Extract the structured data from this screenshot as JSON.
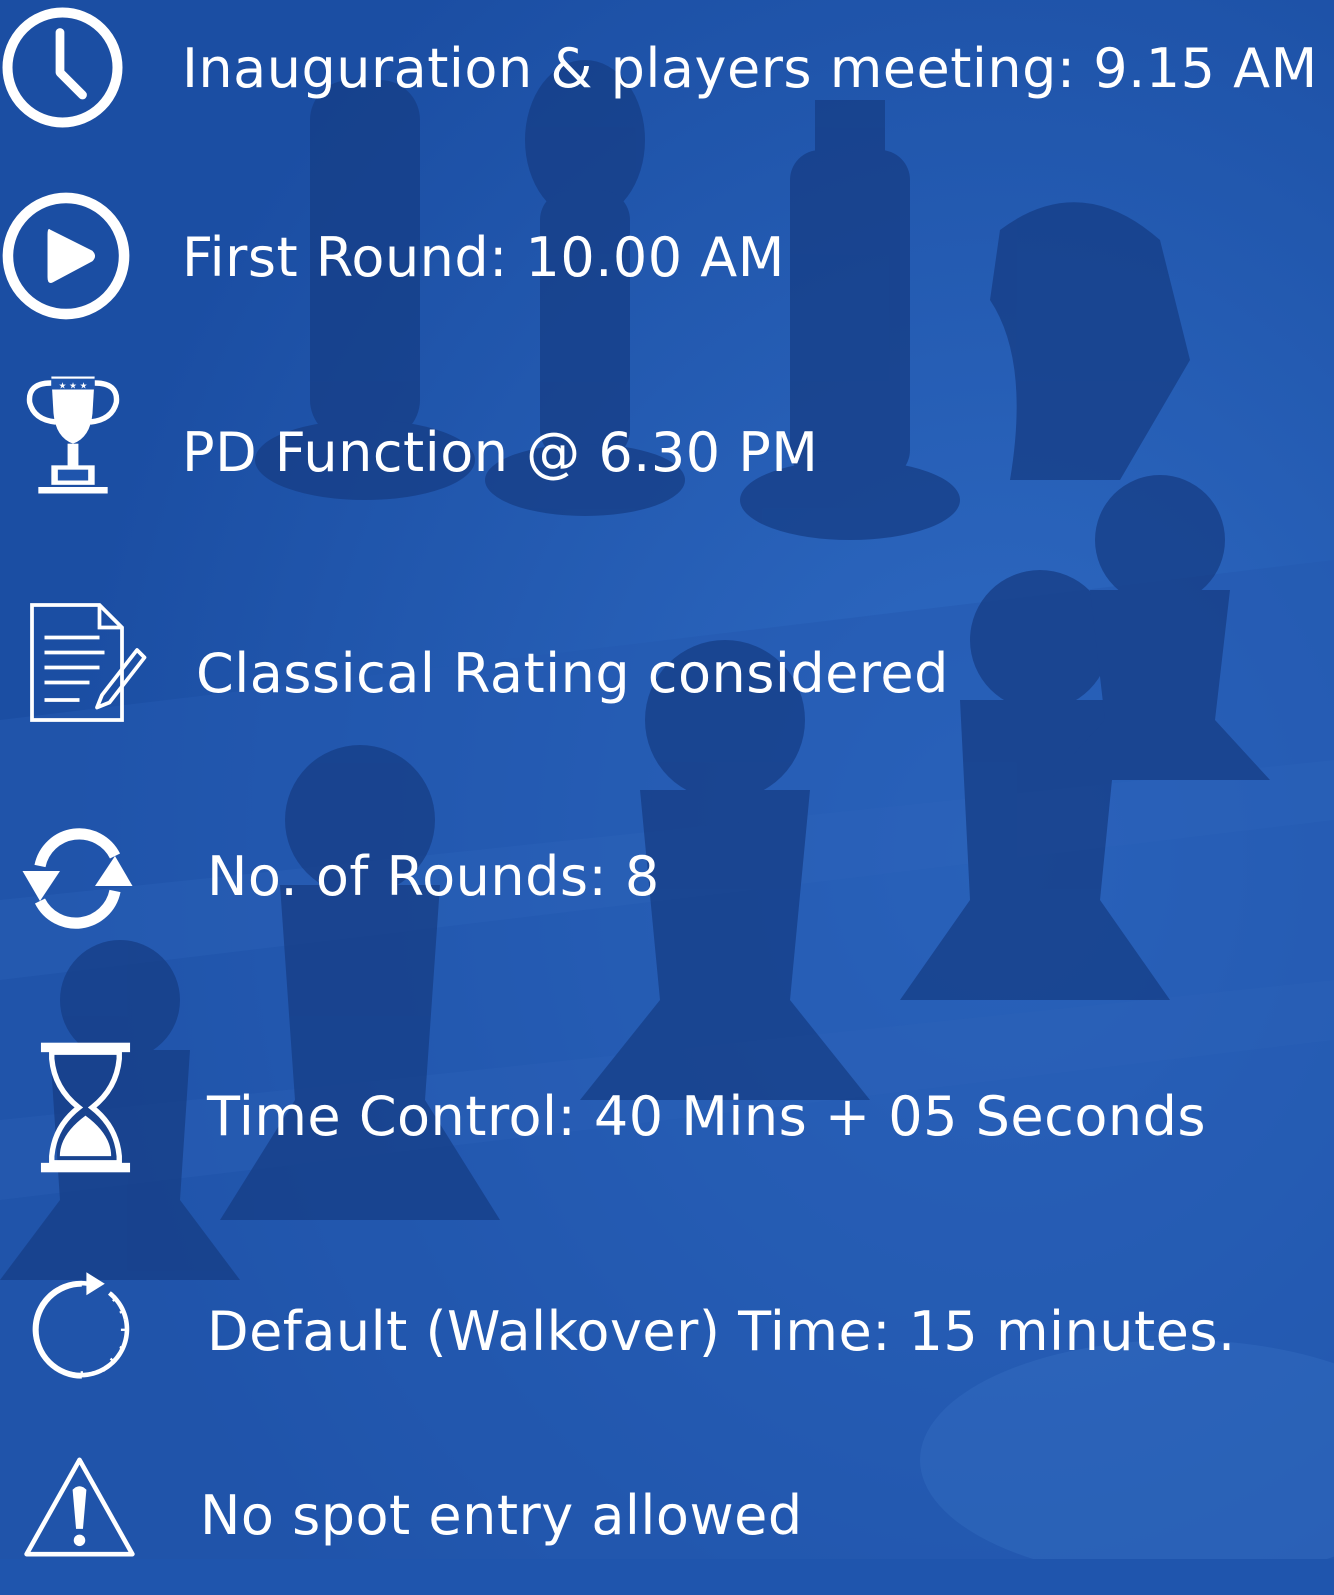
{
  "theme": {
    "background": "#1f55ad",
    "foreground": "#ffffff",
    "pieces": "#1a3f86"
  },
  "background_image": {
    "icon": "chess-board-photo"
  },
  "items": [
    {
      "icon": "clock-icon",
      "text": "Inauguration & players meeting: 9.15 AM"
    },
    {
      "icon": "play-icon",
      "text": "First Round: 10.00 AM"
    },
    {
      "icon": "trophy-icon",
      "text": "PD Function @ 6.30 PM"
    },
    {
      "icon": "document-pen-icon",
      "text": "Classical Rating considered"
    },
    {
      "icon": "refresh-icon",
      "text": "No. of Rounds: 8"
    },
    {
      "icon": "hourglass-icon",
      "text": "Time Control: 40 Mins + 05 Seconds"
    },
    {
      "icon": "timer-icon",
      "text": "Default (Walkover) Time: 15 minutes."
    },
    {
      "icon": "warning-icon",
      "text": "No spot entry allowed"
    }
  ]
}
